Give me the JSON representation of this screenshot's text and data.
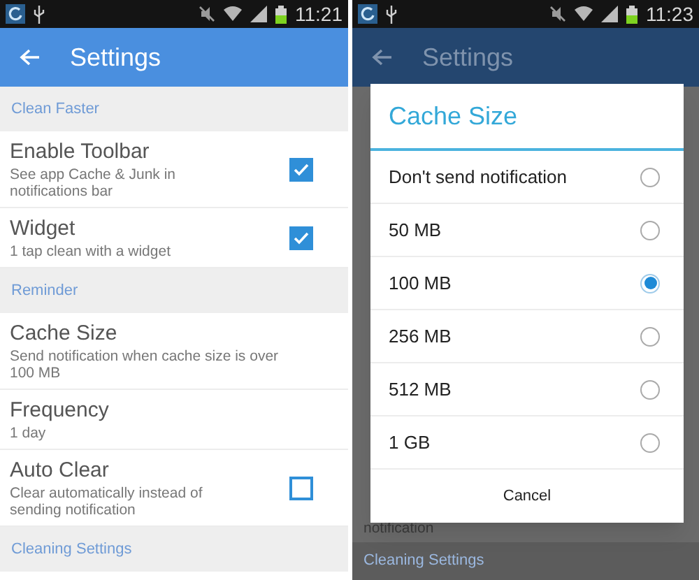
{
  "screens": [
    {
      "status_bar": {
        "time": "11:21"
      },
      "app_bar": {
        "title": "Settings"
      },
      "list": [
        {
          "kind": "section",
          "title": "Clean Faster"
        },
        {
          "kind": "toggle",
          "title": "Enable Toolbar",
          "subtitle": "See app Cache & Junk in notifications bar",
          "checked": true
        },
        {
          "kind": "toggle",
          "title": "Widget",
          "subtitle": "1 tap clean with a widget",
          "checked": true
        },
        {
          "kind": "section",
          "title": "Reminder"
        },
        {
          "kind": "plain",
          "title": "Cache Size",
          "subtitle": "Send notification when cache size is over 100 MB"
        },
        {
          "kind": "plain",
          "title": "Frequency",
          "subtitle": "1 day"
        },
        {
          "kind": "toggle",
          "title": "Auto Clear",
          "subtitle": "Clear automatically instead of sending notification",
          "checked": false
        },
        {
          "kind": "section",
          "title": "Cleaning Settings"
        }
      ]
    },
    {
      "status_bar": {
        "time": "11:23"
      },
      "app_bar": {
        "title": "Settings"
      },
      "list": [
        {
          "kind": "line",
          "title": "notification"
        },
        {
          "kind": "section",
          "title": "Cleaning Settings"
        }
      ],
      "dialog": {
        "title": "Cache Size",
        "options": [
          {
            "label": "Don't send notification",
            "selected": false
          },
          {
            "label": "50 MB",
            "selected": false
          },
          {
            "label": "100 MB",
            "selected": true
          },
          {
            "label": "256 MB",
            "selected": false
          },
          {
            "label": "512 MB",
            "selected": false
          },
          {
            "label": "1 GB",
            "selected": false
          }
        ],
        "cancel": "Cancel"
      }
    }
  ]
}
